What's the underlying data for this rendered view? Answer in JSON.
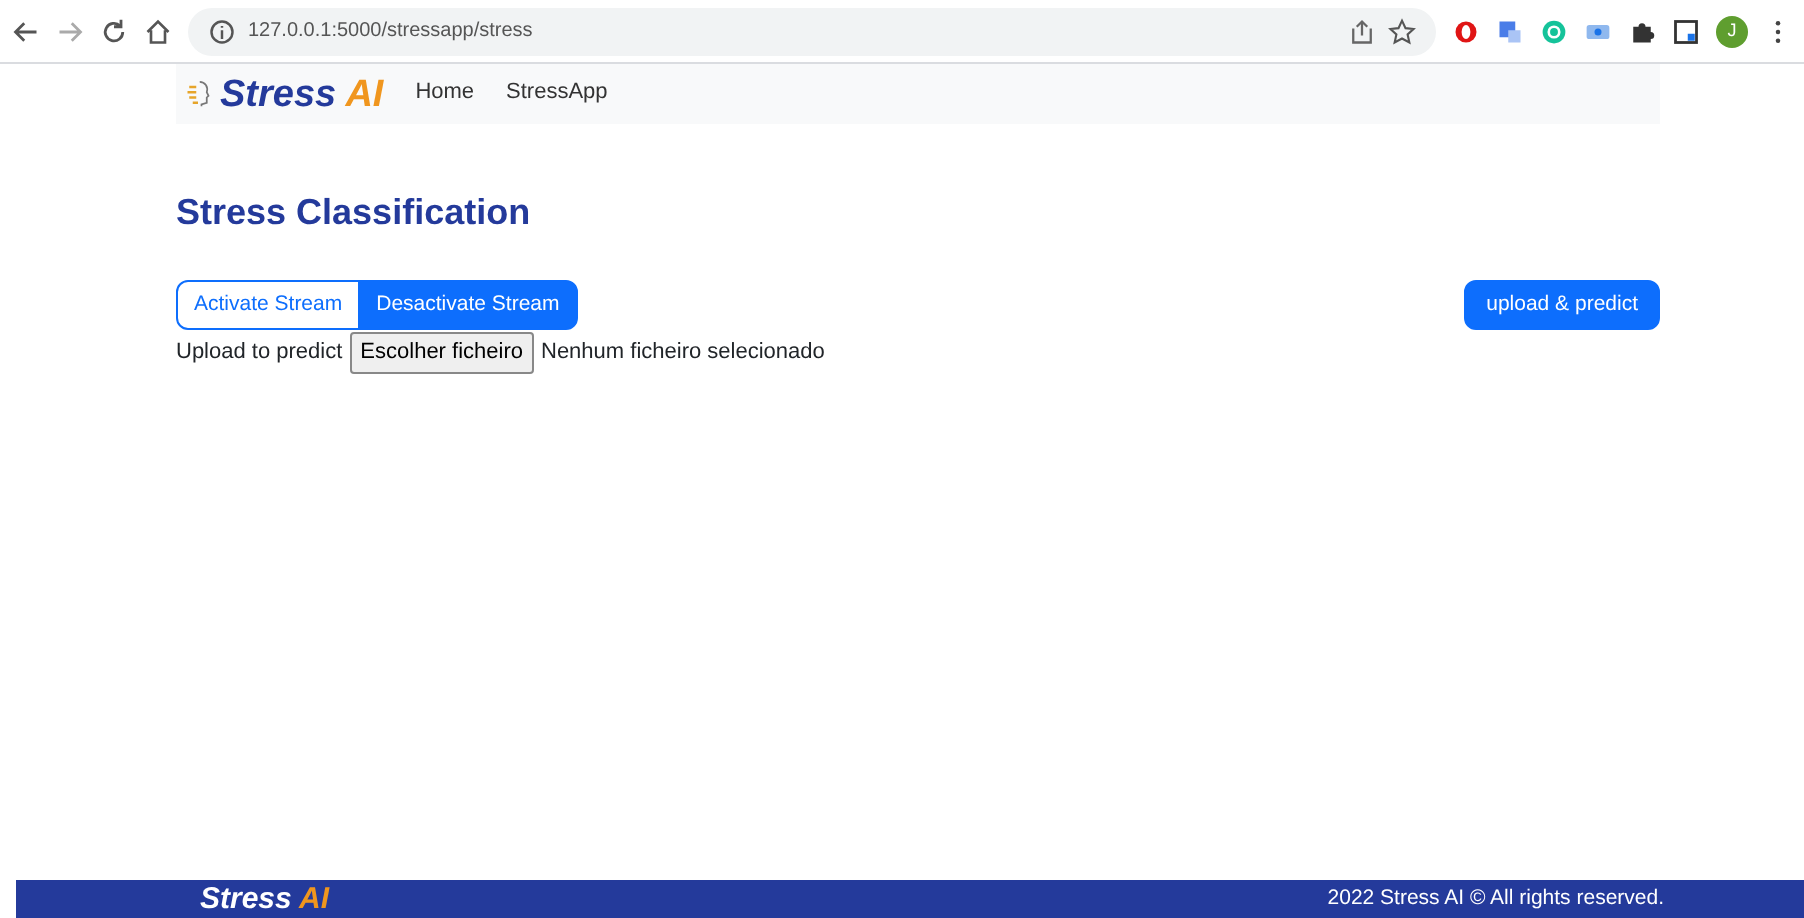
{
  "browser": {
    "url": "127.0.0.1:5000/stressapp/stress",
    "profile_initial": "J"
  },
  "navbar": {
    "brand": [
      "Stress",
      "AI"
    ],
    "links": [
      {
        "label": "Home"
      },
      {
        "label": "StressApp"
      }
    ]
  },
  "heading": "Stress Classification",
  "stream_buttons": [
    {
      "label": "Activate Stream",
      "selected": false
    },
    {
      "label": "Desactivate Stream",
      "selected": true
    }
  ],
  "upload_button": "upload & predict",
  "file_input": {
    "label": "Upload to predict",
    "button": "Escolher ficheiro",
    "status": "Nenhum ficheiro selecionado"
  },
  "footer": {
    "brand": [
      "Stress",
      "AI"
    ],
    "copyright": "2022 Stress AI © All rights reserved."
  }
}
